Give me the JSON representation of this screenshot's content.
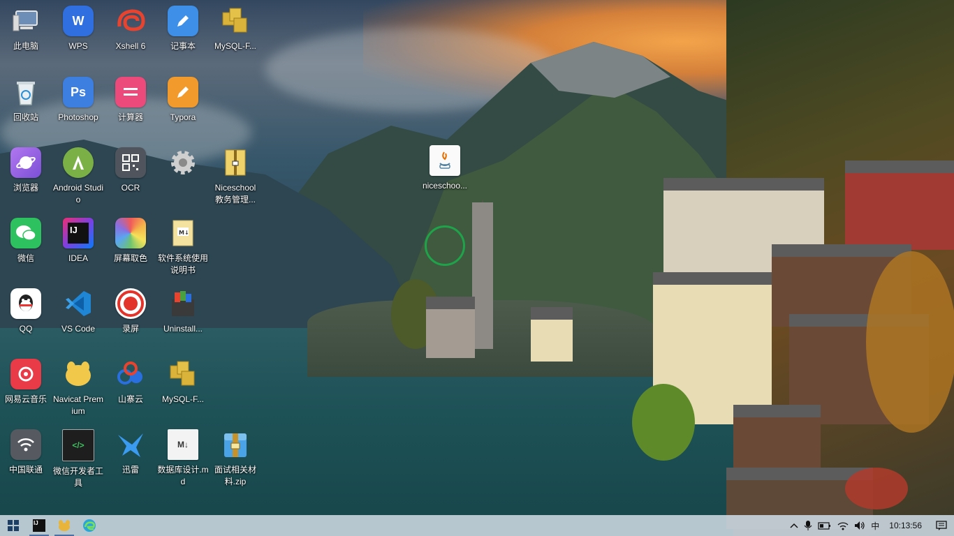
{
  "desktop": {
    "icons": [
      {
        "label": "此电脑",
        "icon": "computer-icon"
      },
      {
        "label": "WPS",
        "icon": "wps-icon"
      },
      {
        "label": "Xshell 6",
        "icon": "xshell-icon"
      },
      {
        "label": "记事本",
        "icon": "notepad-icon"
      },
      {
        "label": "MySQL-F...",
        "icon": "mysql-folder-icon"
      },
      {
        "label": "回收站",
        "icon": "recycle-bin-icon"
      },
      {
        "label": "Photoshop",
        "icon": "photoshop-icon"
      },
      {
        "label": "计算器",
        "icon": "calculator-icon"
      },
      {
        "label": "Typora",
        "icon": "typora-icon"
      },
      {
        "label": "浏览器",
        "icon": "browser-icon"
      },
      {
        "label": "Android Studio",
        "icon": "android-studio-icon"
      },
      {
        "label": "OCR",
        "icon": "ocr-icon"
      },
      {
        "label": "",
        "icon": "settings-gear-icon"
      },
      {
        "label": "Niceschool 教务管理...",
        "icon": "folder-zip-icon"
      },
      {
        "label": "微信",
        "icon": "wechat-icon"
      },
      {
        "label": "IDEA",
        "icon": "intellij-idea-icon"
      },
      {
        "label": "屏幕取色",
        "icon": "color-picker-icon"
      },
      {
        "label": "软件系统使用说明书",
        "icon": "markdown-folder-icon"
      },
      {
        "label": "QQ",
        "icon": "qq-icon"
      },
      {
        "label": "VS Code",
        "icon": "vscode-icon"
      },
      {
        "label": "录屏",
        "icon": "screen-record-icon"
      },
      {
        "label": "Uninstall...",
        "icon": "uninstall-icon"
      },
      {
        "label": "网易云音乐",
        "icon": "netease-music-icon"
      },
      {
        "label": "Navicat Premium",
        "icon": "navicat-icon"
      },
      {
        "label": "山寨云",
        "icon": "shanzhai-cloud-icon"
      },
      {
        "label": "MySQL-F...",
        "icon": "mysql-folder-icon"
      },
      {
        "label": "中国联通",
        "icon": "china-unicom-icon"
      },
      {
        "label": "微信开发者工具",
        "icon": "wechat-devtools-icon"
      },
      {
        "label": "迅雷",
        "icon": "xunlei-icon"
      },
      {
        "label": "数据库设计.md",
        "icon": "markdown-file-icon"
      },
      {
        "label": "面试相关材料.zip",
        "icon": "winrar-zip-icon"
      },
      {
        "label": "niceschoo...",
        "icon": "java-jar-icon"
      }
    ]
  },
  "taskbar": {
    "apps": [
      {
        "name": "start",
        "icon": "windows-start-icon"
      },
      {
        "name": "IntelliJ IDEA",
        "icon": "intellij-idea-icon"
      },
      {
        "name": "Navicat",
        "icon": "navicat-icon"
      },
      {
        "name": "Edge",
        "icon": "edge-icon"
      }
    ],
    "tray": {
      "ime": "中",
      "time": "10:13:56"
    }
  },
  "colors": {
    "cursor_ring": "#1fa34a",
    "taskbar_bg": "#cddae2"
  }
}
